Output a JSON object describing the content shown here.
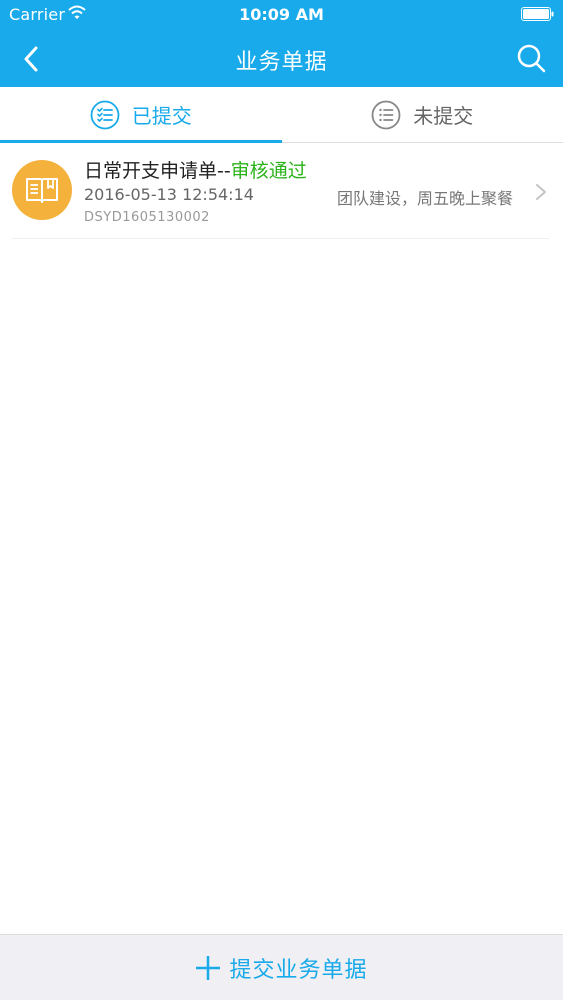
{
  "status_bar": {
    "carrier": "Carrier",
    "time": "10:09 AM",
    "wifi_icon": "wifi-icon",
    "battery_icon": "battery-icon"
  },
  "nav": {
    "title": "业务单据",
    "back_icon": "chevron-left-icon",
    "search_icon": "search-icon"
  },
  "tabs": [
    {
      "label": "已提交",
      "icon": "checklist-icon",
      "active": true
    },
    {
      "label": "未提交",
      "icon": "list-icon",
      "active": false
    }
  ],
  "items": [
    {
      "icon": "book-icon",
      "title": "日常开支申请单",
      "separator": "--",
      "status": "审核通过",
      "datetime": "2016-05-13 12:54:14",
      "remark": "团队建设，周五晚上聚餐",
      "code": "DSYD1605130002"
    }
  ],
  "bottom_action": {
    "icon": "plus-icon",
    "label": "提交业务单据"
  },
  "colors": {
    "primary": "#18aaea",
    "approved": "#2bb319",
    "avatar": "#f4b13c"
  }
}
